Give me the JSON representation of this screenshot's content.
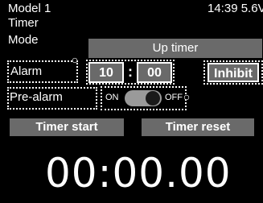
{
  "header": {
    "model": "Model 1",
    "clock": "14:39 5.6V"
  },
  "screen_title": "Timer",
  "mode": {
    "label": "Mode",
    "value": "Up timer"
  },
  "alarm": {
    "label": "Alarm",
    "minutes": "10",
    "separator": ":",
    "seconds": "00",
    "inhibit_label": "Inhibit"
  },
  "prealarm": {
    "label": "Pre-alarm",
    "on_label": "ON",
    "off_label": "OFF",
    "state": "OFF"
  },
  "buttons": {
    "start_label": "Timer start",
    "reset_label": "Timer reset"
  },
  "timer_display": "00:00.00",
  "colors": {
    "background": "#000000",
    "button": "#6a6a6a",
    "text": "#ffffff",
    "toggle_track": "#9a9a9a"
  }
}
